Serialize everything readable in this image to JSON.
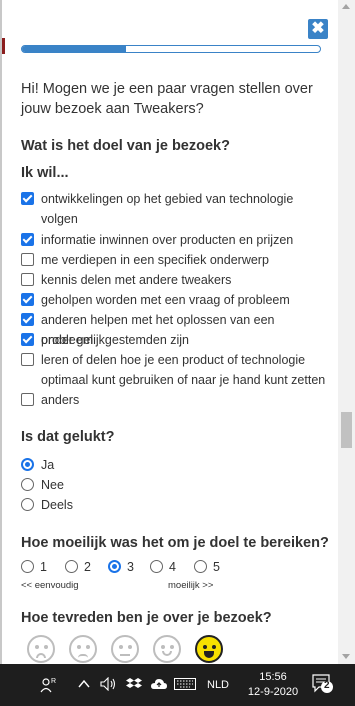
{
  "survey": {
    "close_label": "✖",
    "progress_fraction": 0.35,
    "intro": "Hi! Mogen we je een paar vragen stellen over jouw bezoek aan Tweakers?",
    "q1": {
      "title": "Wat is het doel van je bezoek?",
      "subtitle": "Ik wil...",
      "options": [
        {
          "label": "ontwikkelingen op het gebied van technologie volgen",
          "checked": true
        },
        {
          "label": "informatie inwinnen over producten en prijzen",
          "checked": true
        },
        {
          "label": "me verdiepen in een specifiek onderwerp",
          "checked": false
        },
        {
          "label": "kennis delen met andere tweakers",
          "checked": false
        },
        {
          "label": "geholpen worden met een vraag of probleem",
          "checked": true
        },
        {
          "label": "anderen helpen met het oplossen van een probleem",
          "checked": true
        },
        {
          "label": "onder gelijkgestemden zijn",
          "checked": true
        },
        {
          "label": "leren of delen hoe je een product of technologie optimaal kunt gebruiken of naar je hand kunt zetten",
          "checked": false
        },
        {
          "label": "anders",
          "checked": false
        }
      ]
    },
    "q2": {
      "title": "Is dat gelukt?",
      "options": [
        {
          "label": "Ja",
          "selected": true
        },
        {
          "label": "Nee",
          "selected": false
        },
        {
          "label": "Deels",
          "selected": false
        }
      ]
    },
    "q3": {
      "title": "Hoe moeilijk was het om je doel te bereiken?",
      "scale": [
        "1",
        "2",
        "3",
        "4",
        "5"
      ],
      "selected": "3",
      "hint_low": "<< eenvoudig",
      "hint_high": "moeilijk >>"
    },
    "q4": {
      "title": "Hoe tevreden ben je over je bezoek?",
      "faces": [
        "very-unhappy-face-icon",
        "unhappy-face-icon",
        "neutral-face-icon",
        "smile-face-icon",
        "happy-face-icon"
      ],
      "selected_index": 4
    }
  },
  "colors": {
    "accent": "#3a83c7",
    "checkbox": "#1a73e8",
    "happy_face": "#f7e000"
  },
  "taskbar": {
    "icons": [
      "people-icon",
      "chevron-up-icon",
      "volume-icon",
      "dropbox-icon",
      "cloud-upload-icon",
      "keyboard-icon"
    ],
    "language": "NLD",
    "time": "15:56",
    "date": "12-9-2020",
    "notification_count": "2"
  }
}
